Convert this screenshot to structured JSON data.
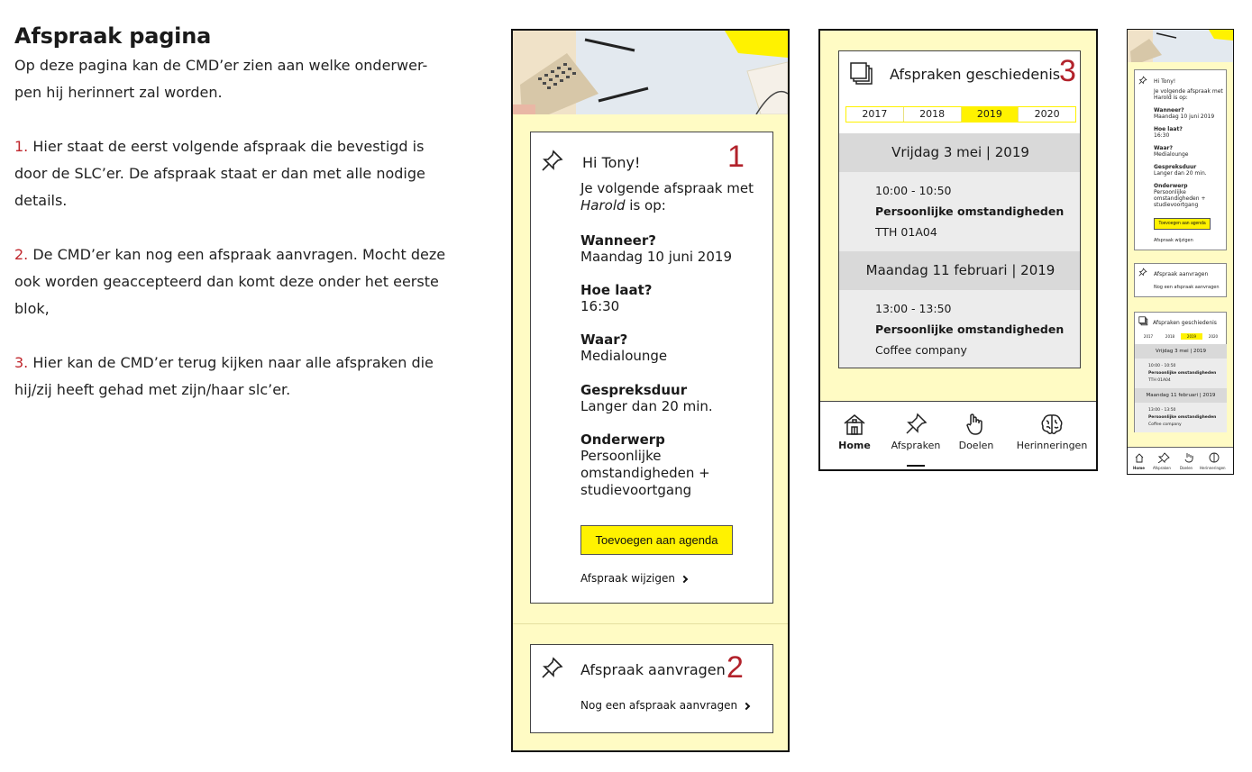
{
  "description": {
    "title": "Afspraak pagina",
    "intro": [
      "Op deze pagina kan de CMD’er zien aan welke onderwer-",
      "pen hij herinnert zal worden."
    ],
    "point1": {
      "num": "1.",
      "lines": [
        " Hier staat de eerst volgende afspraak die bevestigd is",
        "door de SLC’er. De afspraak staat er dan met alle nodige",
        "details."
      ]
    },
    "point2": {
      "num": "2.",
      "lines": [
        " De CMD’er kan nog een afspraak aanvragen. Mocht deze",
        "ook worden geaccepteerd dan komt deze onder het eerste",
        "blok,"
      ]
    },
    "point3": {
      "num": "3.",
      "lines": [
        " Hier kan de CMD’er terug kijken naar alle afspraken die",
        "hij/zij heeft gehad met zijn/haar slc’er."
      ]
    }
  },
  "appointment": {
    "number": "1",
    "greeting": "Hi Tony!",
    "intro1": "Je volgende afspraak met",
    "intro_name": "Harold",
    "intro2": " is op:",
    "when_label": "Wanneer?",
    "when_value": "Maandag 10 juni 2019",
    "time_label": "Hoe laat?",
    "time_value": "16:30",
    "where_label": "Waar?",
    "where_value": "Medialounge",
    "duration_label": "Gespreksduur",
    "duration_value": "Langer dan 20 min.",
    "subject_label": "Onderwerp",
    "subject_lines": [
      "Persoonlijke",
      "omstandigheden +",
      "studievoortgang"
    ],
    "add_button": "Toevoegen aan agenda",
    "change_link": "Afspraak wijzigen"
  },
  "request": {
    "number": "2",
    "title": "Afspraak aanvragen",
    "link": "Nog een afspraak aanvragen"
  },
  "history": {
    "number": "3",
    "title": "Afspraken geschiedenis",
    "years": [
      "2017",
      "2018",
      "2019",
      "2020"
    ],
    "active_year": "2019",
    "days": [
      {
        "date": "Vrijdag 3 mei | 2019",
        "time": "10:00 - 10:50",
        "subject": "Persoonlijke omstandigheden",
        "place": "TTH 01A04"
      },
      {
        "date": "Maandag 11 februari | 2019",
        "time": "13:00 - 13:50",
        "subject": "Persoonlijke omstandigheden",
        "place": "Coffee company"
      }
    ]
  },
  "nav": {
    "home": "Home",
    "afspraken": "Afspraken",
    "doelen": "Doelen",
    "herinneringen": "Herinneringen",
    "icons": [
      "home-icon",
      "pushpin-icon",
      "hand-icon",
      "brain-icon"
    ]
  },
  "mini": {
    "greeting": "Hi Tony!",
    "intro1": "Je volgende afspraak met",
    "intro2": "Harold is op:",
    "when_label": "Wanneer?",
    "when_value": "Maandag 10 juni 2019",
    "time_label": "Hoe laat?",
    "time_value": "16:30",
    "where_label": "Waar?",
    "where_value": "Medialounge",
    "duration_label": "Gespreksduur",
    "duration_value": "Langer dan 20 min.",
    "subject_label": "Onderwerp",
    "subject_lines": [
      "Persoonlijke",
      "omstandigheden +",
      "studievoortgang"
    ],
    "add_button": "Toevoegen aan agenda",
    "change_link": "Afspraak wijzigen",
    "request_title": "Afspraak aanvragen",
    "request_link": "Nog een afspraak aanvragen",
    "history_title": "Afspraken geschiedenis",
    "years": [
      "2017",
      "2018",
      "2019",
      "2020"
    ],
    "day1_date": "Vrijdag 3 mei | 2019",
    "day1_time": "10:00 - 10:50",
    "day1_subject": "Persoonlijke omstandigheden",
    "day1_place": "TTH 01A04",
    "day2_date": "Maandag 11 februari | 2019",
    "day2_time": "13:00 - 13:50",
    "day2_subject": "Persoonlijke omstandigheden",
    "day2_place": "Coffee company",
    "nav": [
      "Home",
      "Afspraken",
      "Doelen",
      "Herinneringen"
    ]
  },
  "colors": {
    "accent_yellow": "#fff200",
    "panel_yellow": "#fffbc4",
    "number_red": "#b2222b",
    "day_header": "#d9d9d9"
  }
}
